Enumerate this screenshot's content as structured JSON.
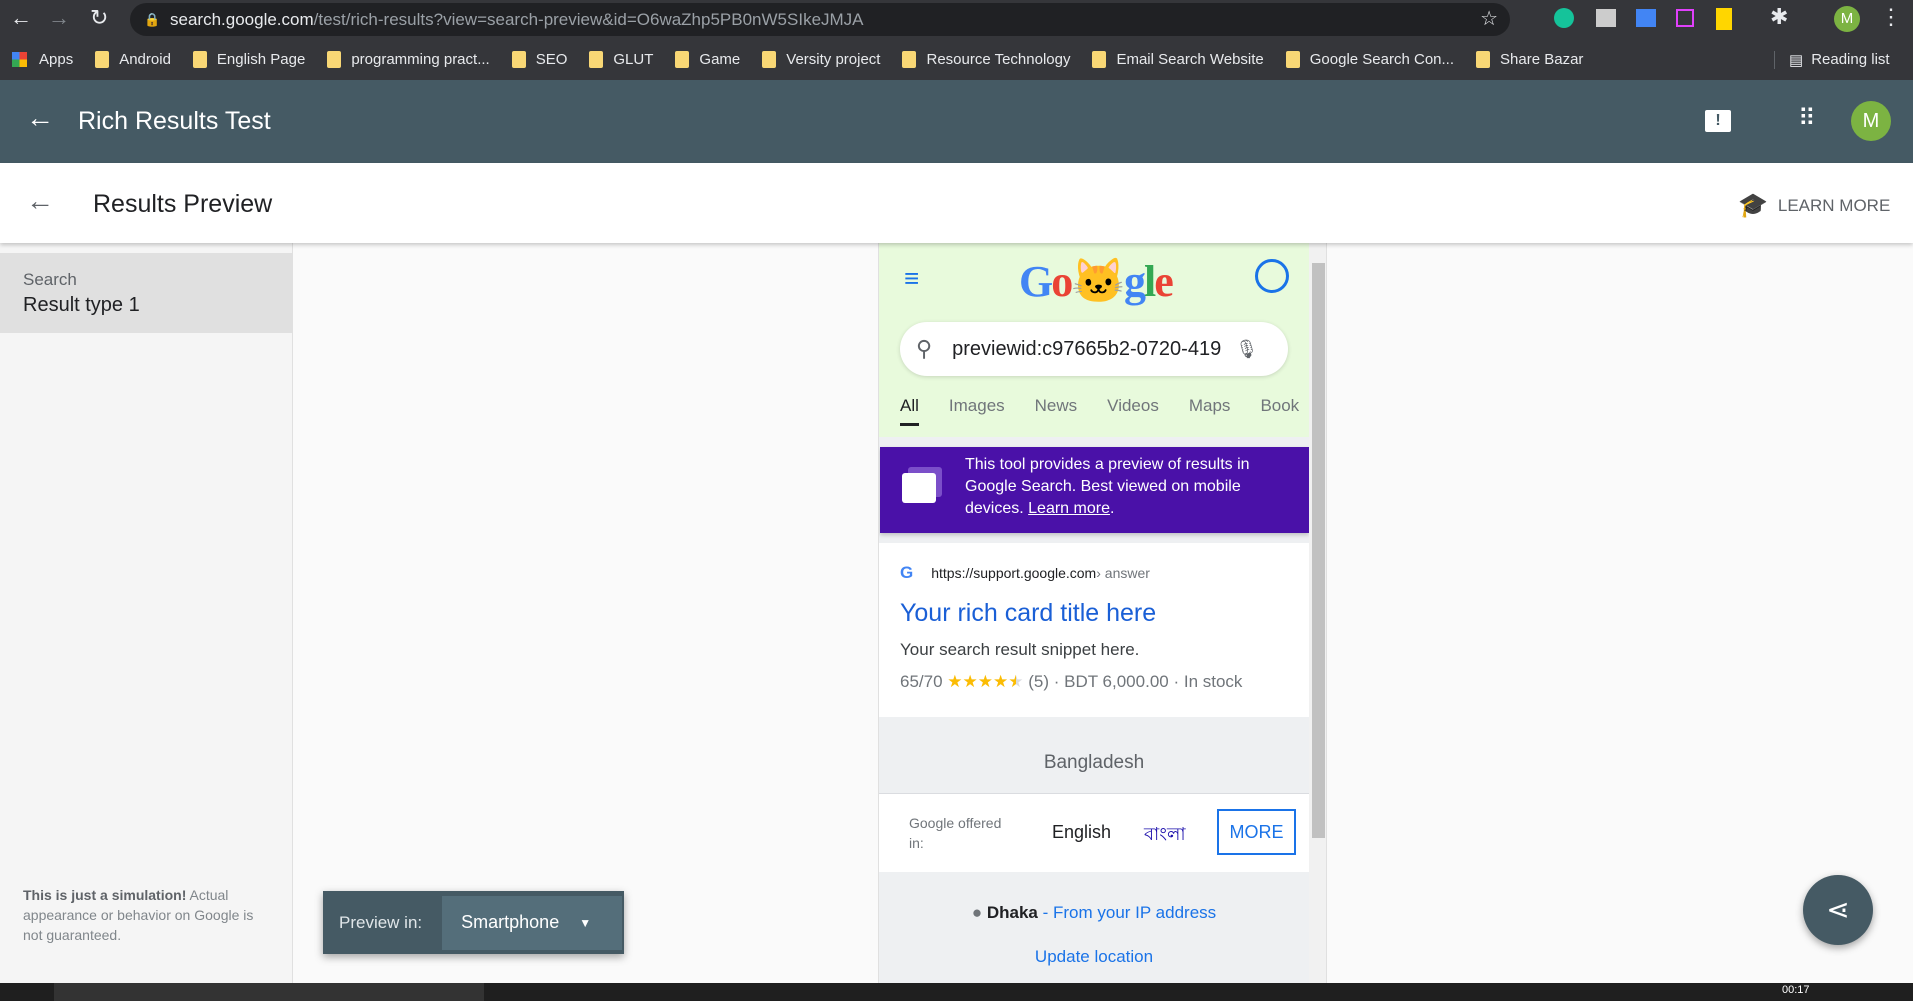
{
  "browser": {
    "url_host": "search.google.com",
    "url_path": "/test/rich-results?view=search-preview&id=O6waZhp5PB0nW5SIkeJMJA",
    "bookmarks": [
      "Apps",
      "Android",
      "English Page",
      "programming pract...",
      "SEO",
      "GLUT",
      "Game",
      "Versity project",
      "Resource Technology",
      "Email Search Website",
      "Google Search Con...",
      "Share Bazar"
    ],
    "reading_list": "Reading list",
    "profile_initial": "M"
  },
  "app": {
    "title": "Rich Results Test",
    "avatar": "M"
  },
  "subheader": {
    "title": "Results Preview",
    "learn_more": "LEARN MORE"
  },
  "sidebar": {
    "item_label": "Search",
    "item_value": "Result type 1",
    "disclaimer_bold": "This is just a simulation!",
    "disclaimer_rest": " Actual appearance or behavior on Google is not guaranteed."
  },
  "preview_bar": {
    "label": "Preview in:",
    "selected": "Smartphone"
  },
  "phone": {
    "query": "previewid:c97665b2-0720-419",
    "tabs": [
      "All",
      "Images",
      "News",
      "Videos",
      "Maps",
      "Book"
    ],
    "banner": {
      "text": "This tool provides a preview of results in Google Search. Best viewed on mobile devices. ",
      "link": "Learn more",
      "end": "."
    },
    "result": {
      "url": "https://support.google.com",
      "crumb": " › answer",
      "title": "Your rich card title here",
      "snippet": "Your search result snippet here.",
      "rating": "65/70",
      "stars": "★★★★",
      "half_star": "★",
      "reviews": "(5)",
      "price": "· BDT 6,000.00",
      "stock": "· In stock"
    },
    "country": "Bangladesh",
    "offered": "Google offered in:",
    "lang1": "English",
    "lang2": "বাংলা",
    "more": "MORE",
    "city": "Dhaka",
    "from_ip": "- From your IP address",
    "update": "Update location"
  },
  "taskbar": {
    "time": "00:17"
  },
  "colors": {
    "appbar": "#455a64",
    "banner": "#4a11a8",
    "link": "#1a0dab"
  }
}
